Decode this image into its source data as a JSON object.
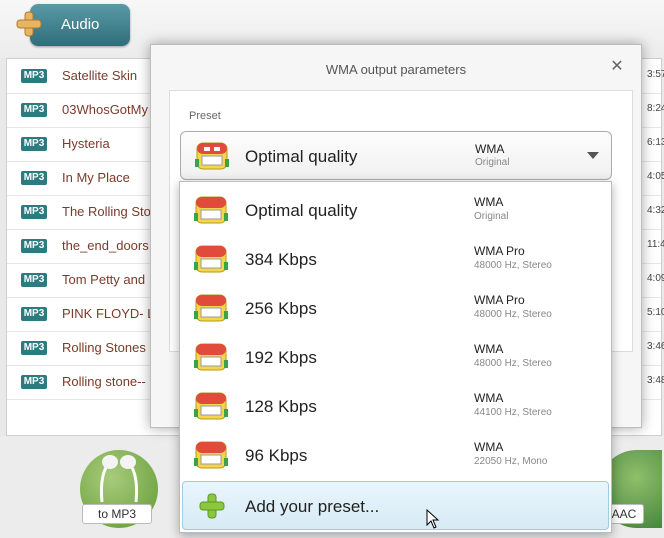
{
  "toolbar": {
    "add_audio_label": "Audio"
  },
  "files": [
    {
      "badge": "MP3",
      "name": "Satellite Skin",
      "duration": "3:57"
    },
    {
      "badge": "MP3",
      "name": "03WhosGotMy",
      "duration": "8:24"
    },
    {
      "badge": "MP3",
      "name": "Hysteria",
      "duration": "6:13"
    },
    {
      "badge": "MP3",
      "name": "In My Place",
      "duration": "4:05"
    },
    {
      "badge": "MP3",
      "name": "The Rolling Sto",
      "duration": "4:32"
    },
    {
      "badge": "MP3",
      "name": "the_end_doors",
      "duration": "11:4"
    },
    {
      "badge": "MP3",
      "name": "Tom Petty and",
      "duration": "4:09"
    },
    {
      "badge": "MP3",
      "name": "PINK FLOYD- L",
      "duration": "5:10"
    },
    {
      "badge": "MP3",
      "name": "Rolling Stones",
      "duration": "3:46"
    },
    {
      "badge": "MP3",
      "name": "Rolling stone--",
      "duration": "3:48"
    }
  ],
  "converters": {
    "mp3_label": "to MP3",
    "aac_label": "AAC"
  },
  "dialog": {
    "title": "WMA output parameters",
    "close_icon": "close-icon",
    "preset_label": "Preset",
    "selected": {
      "name": "Optimal quality",
      "format": "WMA",
      "sub": "Original"
    },
    "options": [
      {
        "name": "Optimal quality",
        "format": "WMA",
        "sub": "Original"
      },
      {
        "name": "384 Kbps",
        "format": "WMA Pro",
        "sub": "48000 Hz,  Stereo"
      },
      {
        "name": "256 Kbps",
        "format": "WMA Pro",
        "sub": "48000 Hz,  Stereo"
      },
      {
        "name": "192 Kbps",
        "format": "WMA",
        "sub": "48000 Hz,  Stereo"
      },
      {
        "name": "128 Kbps",
        "format": "WMA",
        "sub": "44100 Hz,  Stereo"
      },
      {
        "name": "96 Kbps",
        "format": "WMA",
        "sub": "22050 Hz,  Mono"
      }
    ],
    "add_preset_label": "Add your preset..."
  },
  "colors": {
    "accent": "#2f6d7b",
    "badge": "#2b7b80",
    "filename": "#7a3b2a",
    "highlight": "#d6ebf6"
  }
}
